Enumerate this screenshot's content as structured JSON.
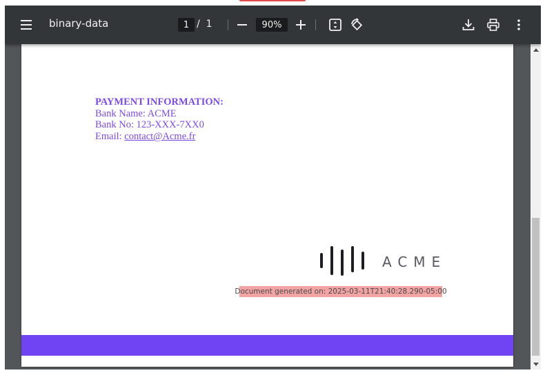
{
  "viewer": {
    "title": "binary-data",
    "current_page": "1",
    "page_separator": "/",
    "total_pages": "1",
    "zoom": "90%"
  },
  "icons": {
    "menu": "menu-icon",
    "zoom_out": "minus-icon",
    "zoom_in": "plus-icon",
    "fit": "fit-to-page-icon",
    "rotate": "rotate-icon",
    "download": "download-icon",
    "print": "print-icon",
    "more": "more-vertical-icon"
  },
  "document": {
    "payment": {
      "heading": "PAYMENT INFORMATION:",
      "bank_name": "Bank Name: ACME",
      "bank_no": "Bank No: 123-XXX-7XX0",
      "email_label": "Email: ",
      "email_link": "contact@Acme.fr"
    },
    "logo_text": "ACME",
    "generated_note": "Document generated on: 2025-03-11T21:40:28.290-05:00"
  },
  "colors": {
    "accent": "#7b4ae8",
    "footer_band": "#7044f2",
    "note_highlight": "#f2a3a3",
    "toolbar": "#323639",
    "viewer_background": "#525659"
  }
}
